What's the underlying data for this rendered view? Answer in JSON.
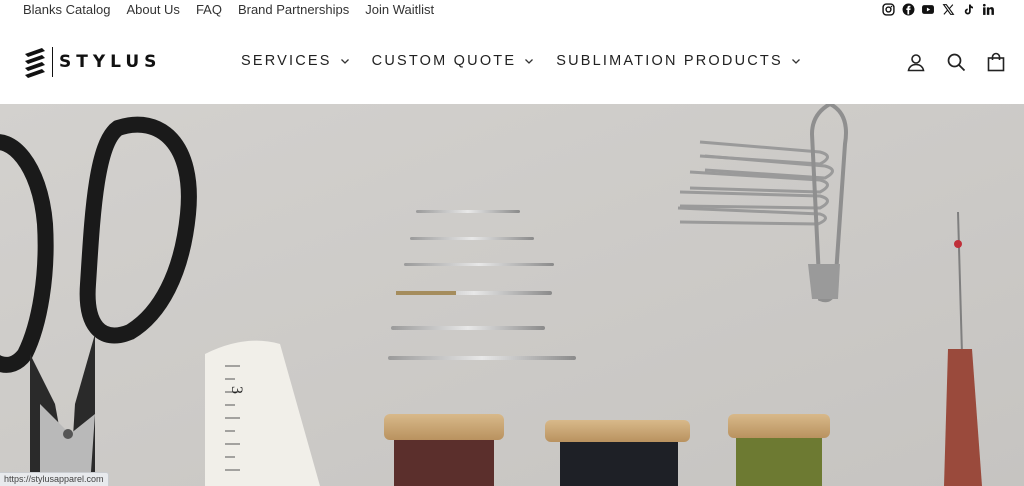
{
  "utility": {
    "links": [
      {
        "label": "Blanks Catalog"
      },
      {
        "label": "About Us"
      },
      {
        "label": "FAQ"
      },
      {
        "label": "Brand Partnerships"
      },
      {
        "label": "Join Waitlist"
      }
    ],
    "social_icons": [
      "instagram-icon",
      "facebook-icon",
      "youtube-icon",
      "x-icon",
      "tiktok-icon",
      "linkedin-icon"
    ]
  },
  "header": {
    "logo_text": "STYLUS",
    "nav": [
      {
        "label": "SERVICES"
      },
      {
        "label": "CUSTOM QUOTE"
      },
      {
        "label": "SUBLIMATION PRODUCTS"
      }
    ],
    "icons": [
      "account-icon",
      "search-icon",
      "cart-icon"
    ]
  },
  "hero": {
    "image_subject": "sewing tools",
    "tape_number": "3"
  },
  "status_bar": {
    "url": "https://stylusapparel.com"
  },
  "colors": {
    "hero_bg": "#cfcdca",
    "text": "#111111"
  }
}
